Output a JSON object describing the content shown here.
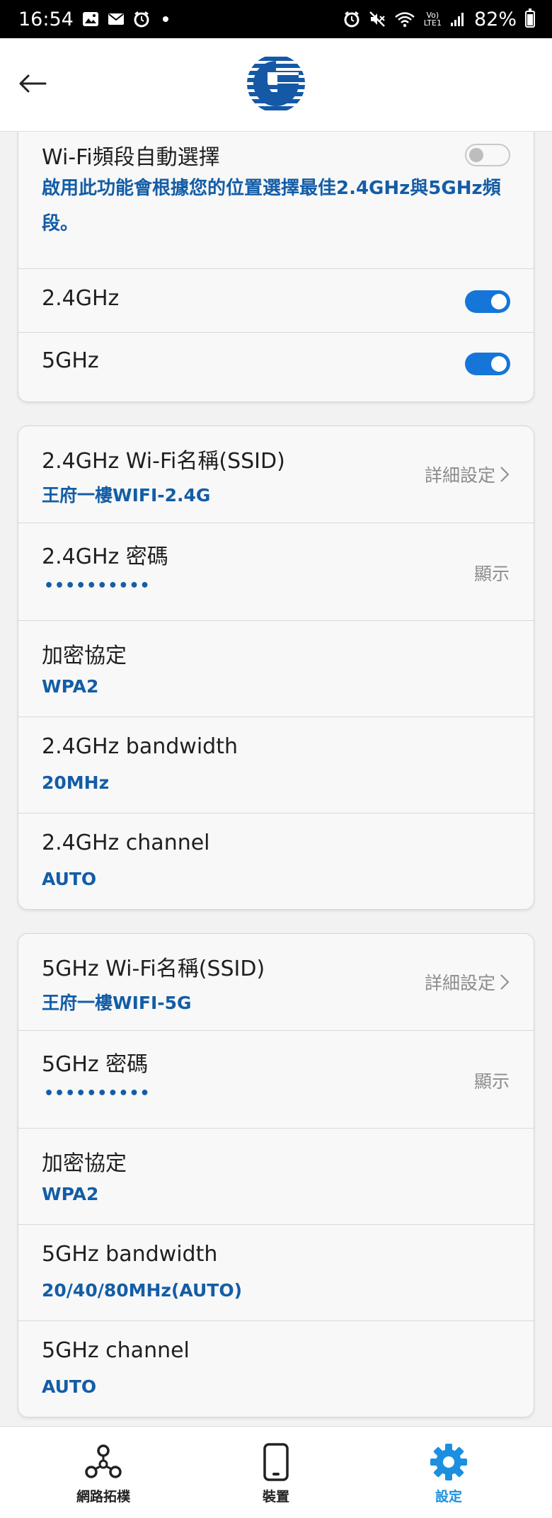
{
  "status_bar": {
    "time": "16:54",
    "left_icons": [
      "image-icon",
      "mail-icon",
      "alarm-clock-icon",
      "dot-icon"
    ],
    "right_icons": [
      "alarm-icon",
      "mute-icon",
      "wifi-icon",
      "volte-icon",
      "signal-icon"
    ],
    "volte_line1": "Vo)",
    "volte_line2": "LTE1",
    "battery": "82%"
  },
  "header": {
    "back_icon": "arrow-left-icon",
    "logo_icon": "chunghwa-telecom-logo-icon",
    "brand_color": "#1559a6"
  },
  "band_card": {
    "auto_select": {
      "label": "Wi-Fi頻段自動選擇",
      "description": "啟用此功能會根據您的位置選擇最佳2.4GHz與5GHz頻段。",
      "enabled": false
    },
    "band_24": {
      "label": "2.4GHz",
      "enabled": true
    },
    "band_5": {
      "label": "5GHz",
      "enabled": true
    }
  },
  "card_24": {
    "ssid": {
      "label": "2.4GHz Wi-Fi名稱(SSID)",
      "value": "王府一樓WIFI-2.4G",
      "action": "詳細設定"
    },
    "password": {
      "label": "2.4GHz 密碼",
      "value": "••••••••••",
      "action": "顯示"
    },
    "encryption": {
      "label": "加密協定",
      "value": "WPA2"
    },
    "bandwidth": {
      "label": "2.4GHz bandwidth",
      "value": "20MHz"
    },
    "channel": {
      "label": "2.4GHz channel",
      "value": "AUTO"
    }
  },
  "card_5": {
    "ssid": {
      "label": "5GHz Wi-Fi名稱(SSID)",
      "value": "王府一樓WIFI-5G",
      "action": "詳細設定"
    },
    "password": {
      "label": "5GHz 密碼",
      "value": "••••••••••",
      "action": "顯示"
    },
    "encryption": {
      "label": "加密協定",
      "value": "WPA2"
    },
    "bandwidth": {
      "label": "5GHz bandwidth",
      "value": "20/40/80MHz(AUTO)"
    },
    "channel": {
      "label": "5GHz channel",
      "value": "AUTO"
    }
  },
  "bottom_nav": {
    "items": [
      {
        "label": "網路拓樸",
        "icon": "network-topology-icon",
        "active": false
      },
      {
        "label": "裝置",
        "icon": "phone-device-icon",
        "active": false
      },
      {
        "label": "設定",
        "icon": "gear-icon",
        "active": true
      }
    ]
  },
  "colors": {
    "accent_blue": "#135da6",
    "toggle_on": "#1575d9",
    "nav_active": "#1b8fe0"
  }
}
